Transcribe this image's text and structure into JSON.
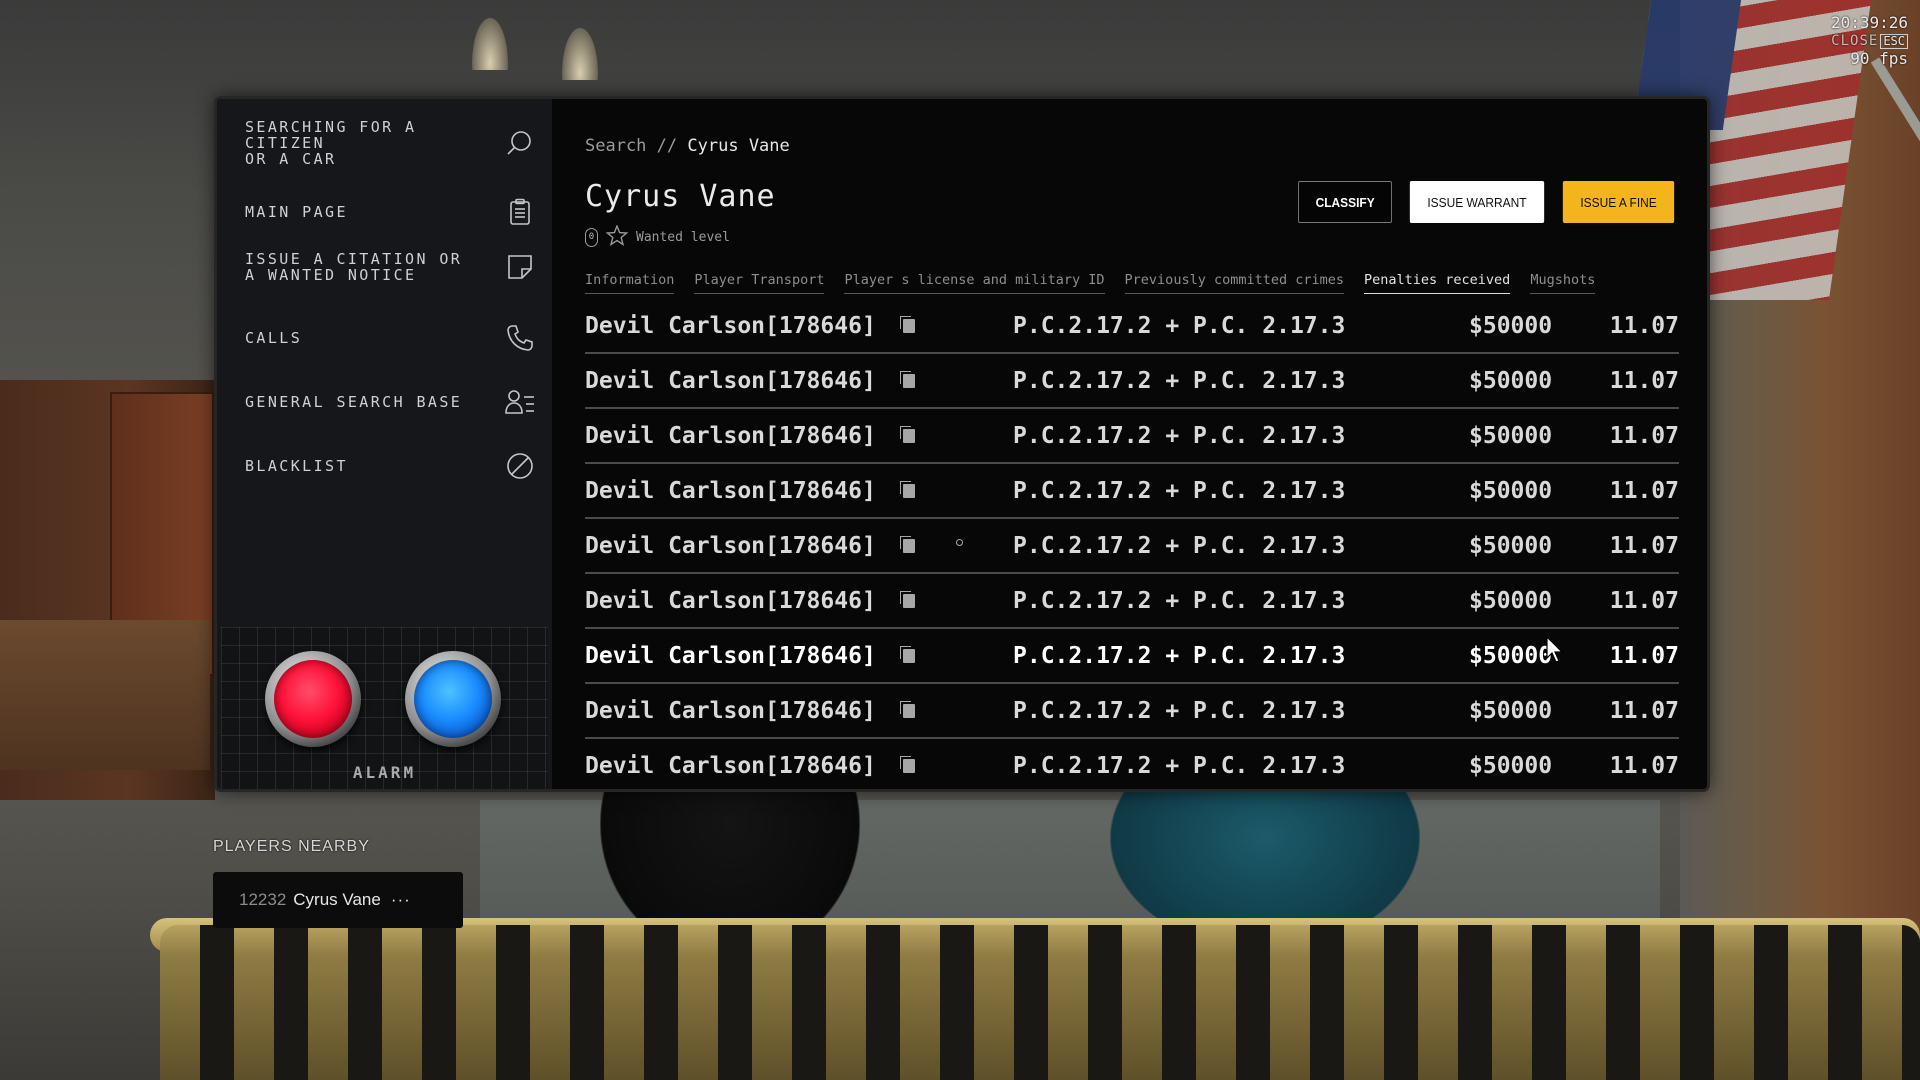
{
  "hud": {
    "time": "20:39:26",
    "fps": "90 fps",
    "close_label": "CLOSE",
    "esc_label": "ESC"
  },
  "sidebar": {
    "items": [
      {
        "label": "SEARCHING FOR A CITIZEN\nOR A CAR",
        "icon": "search-icon"
      },
      {
        "label": "MAIN PAGE",
        "icon": "clipboard-icon"
      },
      {
        "label": "ISSUE A CITATION OR A WANTED NOTICE",
        "icon": "note-icon"
      },
      {
        "label": "CALLS",
        "icon": "phone-icon"
      },
      {
        "label": "GENERAL SEARCH BASE",
        "icon": "user-list-icon"
      },
      {
        "label": "BLACKLIST",
        "icon": "ban-icon"
      }
    ],
    "alarm_label": "ALARM",
    "alarm_colors": {
      "red": "#ff1239",
      "blue": "#1a8cff"
    }
  },
  "main": {
    "breadcrumb": {
      "root": "Search",
      "separator": "//",
      "current": "Cyrus Vane"
    },
    "citizen_name": "Cyrus Vane",
    "wanted": {
      "count": "0",
      "label": "Wanted level"
    },
    "actions": {
      "classify": "CLASSIFY",
      "warrant": "ISSUE WARRANT",
      "fine": "ISSUE A FINE"
    },
    "accent_color": "#f4b51c",
    "tabs": [
      {
        "label": "Information",
        "active": false
      },
      {
        "label": "Player Transport",
        "active": false
      },
      {
        "label": "Player s license and military ID",
        "active": false
      },
      {
        "label": "Previously committed crimes",
        "active": false
      },
      {
        "label": "Penalties received",
        "active": true
      },
      {
        "label": "Mugshots",
        "active": false
      }
    ],
    "penalties": [
      {
        "officer": "Devil Carlson[178646]",
        "law": "P.C.2.17.2 + P.C. 2.17.3",
        "amount": "$50000",
        "date": "11.07"
      },
      {
        "officer": "Devil Carlson[178646]",
        "law": "P.C.2.17.2 + P.C. 2.17.3",
        "amount": "$50000",
        "date": "11.07"
      },
      {
        "officer": "Devil Carlson[178646]",
        "law": "P.C.2.17.2 + P.C. 2.17.3",
        "amount": "$50000",
        "date": "11.07"
      },
      {
        "officer": "Devil Carlson[178646]",
        "law": "P.C.2.17.2 + P.C. 2.17.3",
        "amount": "$50000",
        "date": "11.07"
      },
      {
        "officer": "Devil Carlson[178646]",
        "law": "P.C.2.17.2 + P.C. 2.17.3",
        "amount": "$50000",
        "date": "11.07"
      },
      {
        "officer": "Devil Carlson[178646]",
        "law": "P.C.2.17.2 + P.C. 2.17.3",
        "amount": "$50000",
        "date": "11.07"
      },
      {
        "officer": "Devil Carlson[178646]",
        "law": "P.C.2.17.2 + P.C. 2.17.3",
        "amount": "$50000",
        "date": "11.07"
      },
      {
        "officer": "Devil Carlson[178646]",
        "law": "P.C.2.17.2 + P.C. 2.17.3",
        "amount": "$50000",
        "date": "11.07"
      },
      {
        "officer": "Devil Carlson[178646]",
        "law": "P.C.2.17.2 + P.C. 2.17.3",
        "amount": "$50000",
        "date": "11.07"
      }
    ]
  },
  "nearby": {
    "title": "PLAYERS NEARBY",
    "players": [
      {
        "id": "12232",
        "name": "Cyrus Vane",
        "more": "···"
      }
    ]
  }
}
